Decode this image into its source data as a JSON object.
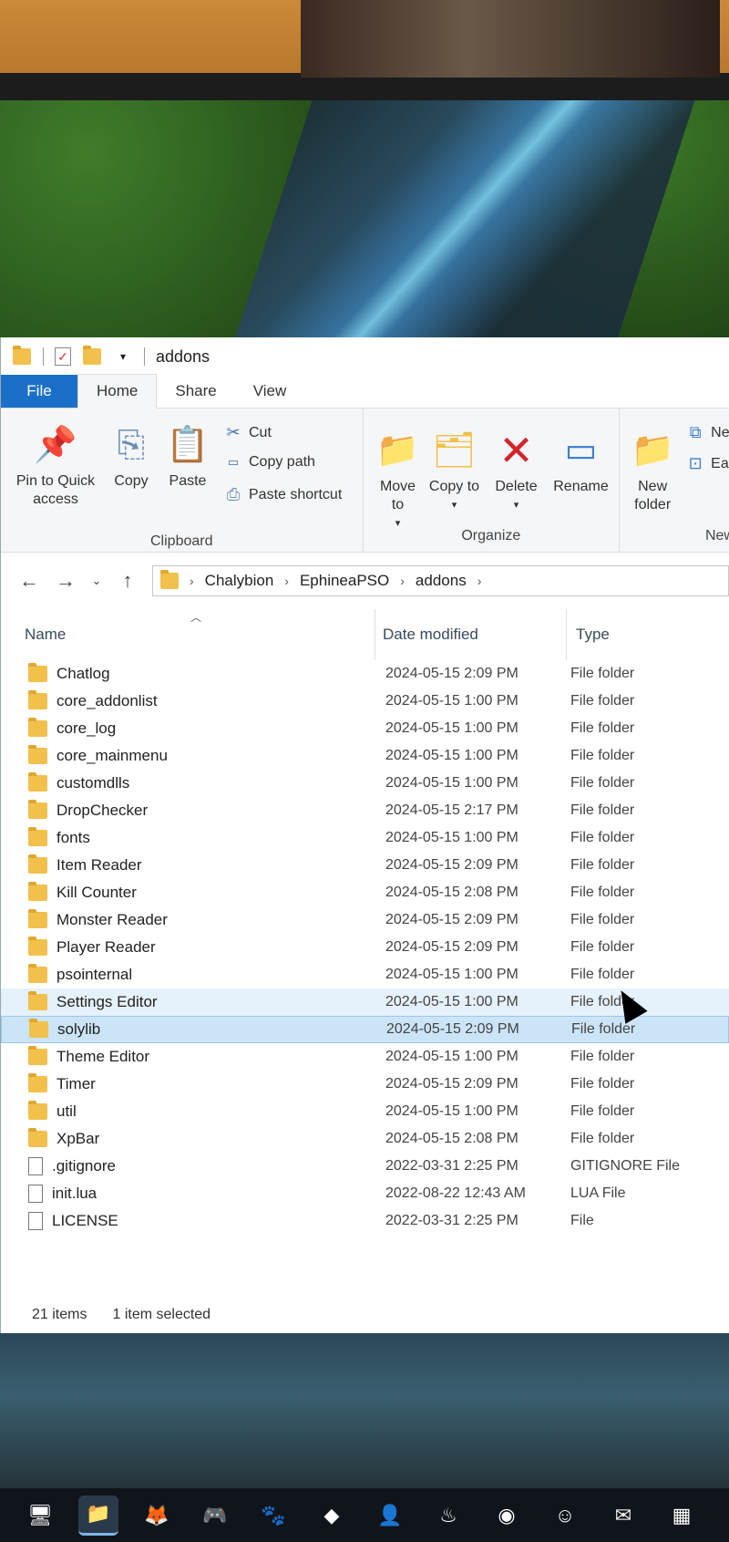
{
  "window": {
    "title": "addons",
    "quick_access_icons": [
      "folder-icon",
      "properties-check-icon",
      "new-folder-icon",
      "customize-dropdown-icon"
    ]
  },
  "ribbon_tabs": [
    "File",
    "Home",
    "Share",
    "View"
  ],
  "ribbon": {
    "clipboard": {
      "label": "Clipboard",
      "pin": "Pin to Quick access",
      "copy": "Copy",
      "paste": "Paste",
      "cut": "Cut",
      "copy_path": "Copy path",
      "paste_shortcut": "Paste shortcut"
    },
    "organize": {
      "label": "Organize",
      "move_to": "Move to",
      "copy_to": "Copy to",
      "delete": "Delete",
      "rename": "Rename"
    },
    "new": {
      "label": "New",
      "new_folder": "New folder",
      "new_item": "Ne",
      "easy_access": "Ea"
    }
  },
  "address": {
    "segments": [
      "Chalybion",
      "EphineaPSO",
      "addons"
    ]
  },
  "columns": {
    "name": "Name",
    "date": "Date modified",
    "type": "Type"
  },
  "files": [
    {
      "name": "Chatlog",
      "date": "2024-05-15 2:09 PM",
      "type": "File folder",
      "kind": "folder"
    },
    {
      "name": "core_addonlist",
      "date": "2024-05-15 1:00 PM",
      "type": "File folder",
      "kind": "folder"
    },
    {
      "name": "core_log",
      "date": "2024-05-15 1:00 PM",
      "type": "File folder",
      "kind": "folder"
    },
    {
      "name": "core_mainmenu",
      "date": "2024-05-15 1:00 PM",
      "type": "File folder",
      "kind": "folder"
    },
    {
      "name": "customdlls",
      "date": "2024-05-15 1:00 PM",
      "type": "File folder",
      "kind": "folder"
    },
    {
      "name": "DropChecker",
      "date": "2024-05-15 2:17 PM",
      "type": "File folder",
      "kind": "folder"
    },
    {
      "name": "fonts",
      "date": "2024-05-15 1:00 PM",
      "type": "File folder",
      "kind": "folder"
    },
    {
      "name": "Item Reader",
      "date": "2024-05-15 2:09 PM",
      "type": "File folder",
      "kind": "folder"
    },
    {
      "name": "Kill Counter",
      "date": "2024-05-15 2:08 PM",
      "type": "File folder",
      "kind": "folder"
    },
    {
      "name": "Monster Reader",
      "date": "2024-05-15 2:09 PM",
      "type": "File folder",
      "kind": "folder"
    },
    {
      "name": "Player Reader",
      "date": "2024-05-15 2:09 PM",
      "type": "File folder",
      "kind": "folder"
    },
    {
      "name": "psointernal",
      "date": "2024-05-15 1:00 PM",
      "type": "File folder",
      "kind": "folder"
    },
    {
      "name": "Settings Editor",
      "date": "2024-05-15 1:00 PM",
      "type": "File folder",
      "kind": "folder",
      "state": "hover"
    },
    {
      "name": "solylib",
      "date": "2024-05-15 2:09 PM",
      "type": "File folder",
      "kind": "folder",
      "state": "selected"
    },
    {
      "name": "Theme Editor",
      "date": "2024-05-15 1:00 PM",
      "type": "File folder",
      "kind": "folder"
    },
    {
      "name": "Timer",
      "date": "2024-05-15 2:09 PM",
      "type": "File folder",
      "kind": "folder"
    },
    {
      "name": "util",
      "date": "2024-05-15 1:00 PM",
      "type": "File folder",
      "kind": "folder"
    },
    {
      "name": "XpBar",
      "date": "2024-05-15 2:08 PM",
      "type": "File folder",
      "kind": "folder"
    },
    {
      "name": ".gitignore",
      "date": "2022-03-31 2:25 PM",
      "type": "GITIGNORE File",
      "kind": "file"
    },
    {
      "name": "init.lua",
      "date": "2022-08-22 12:43 AM",
      "type": "LUA File",
      "kind": "file"
    },
    {
      "name": "LICENSE",
      "date": "2022-03-31 2:25 PM",
      "type": "File",
      "kind": "file"
    }
  ],
  "status": {
    "items": "21 items",
    "selected": "1 item selected"
  },
  "taskbar": {
    "icons": [
      "desktop-icon",
      "file-explorer-icon",
      "fox-mask-icon",
      "game-app-icon",
      "animal-app-icon",
      "box-app-icon",
      "character-app-icon",
      "steam-icon",
      "chrome-icon",
      "discord-icon",
      "outlook-icon",
      "calendar-icon"
    ]
  },
  "colors": {
    "accent": "#1a6fc9",
    "folder": "#f1c14b",
    "selection": "#cce4f7",
    "hover": "#e5f1fb"
  }
}
